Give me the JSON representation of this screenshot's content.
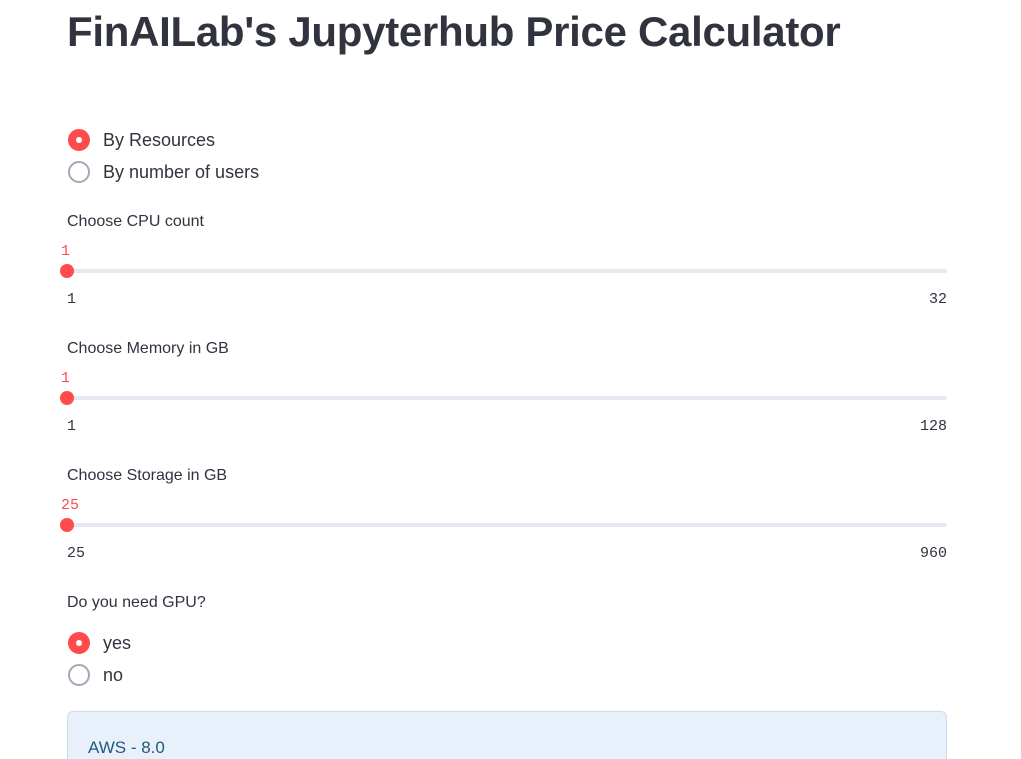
{
  "page": {
    "title": "FinAILab's Jupyterhub Price Calculator"
  },
  "calc_mode": {
    "options": [
      {
        "label": "By Resources",
        "selected": true
      },
      {
        "label": "By number of users",
        "selected": false
      }
    ]
  },
  "cpu_slider": {
    "label": "Choose CPU count",
    "value": 1,
    "min": 1,
    "max": 32
  },
  "memory_slider": {
    "label": "Choose Memory in GB",
    "value": 1,
    "min": 1,
    "max": 128
  },
  "storage_slider": {
    "label": "Choose Storage in GB",
    "value": 25,
    "min": 25,
    "max": 960
  },
  "gpu_question": {
    "label": "Do you need GPU?",
    "options": [
      {
        "label": "yes",
        "selected": true
      },
      {
        "label": "no",
        "selected": false
      }
    ]
  },
  "result": {
    "text": "AWS - 8.0"
  },
  "colors": {
    "accent": "#ff4b4b",
    "track": "#e6e9ef",
    "text": "#31333f",
    "info_bg": "#e8f1fb",
    "info_text": "#1f5a7a"
  }
}
